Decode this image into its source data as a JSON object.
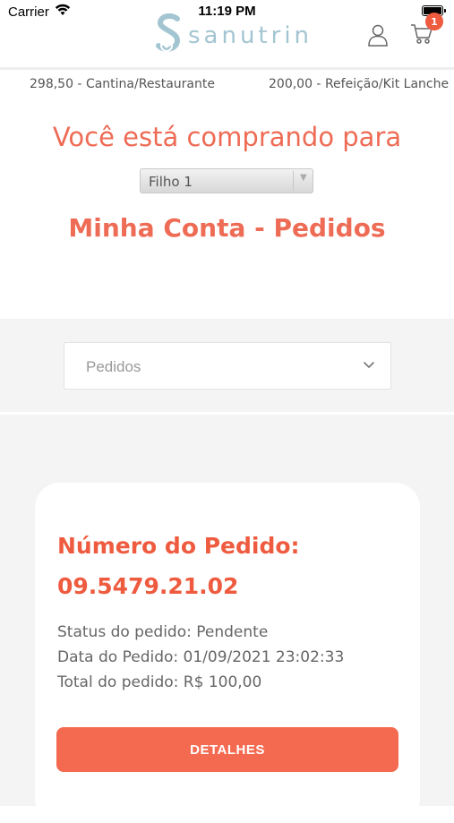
{
  "status_bar": {
    "carrier": "Carrier",
    "time": "11:19 PM"
  },
  "header": {
    "logo_text": "sanutrin",
    "cart_badge": "1",
    "icons": [
      "user-icon",
      "cart-icon",
      "wifi-icon",
      "battery-icon",
      "chevron-down-icon"
    ]
  },
  "balances": [
    "298,50 - Cantina/Restaurante",
    "200,00 - Refeição/Kit Lanche"
  ],
  "buying_for": {
    "label": "Você está comprando para",
    "selected_child": "Filho 1"
  },
  "page_heading": "Minha Conta - Pedidos",
  "orders_filter": {
    "selected": "Pedidos"
  },
  "order": {
    "title": "Número do Pedido:",
    "number": "09.5479.21.02",
    "status": "Status do pedido: Pendente",
    "date": "Data do Pedido: 01/09/2021 23:02:33",
    "total": "Total do pedido: R$ 100,00",
    "details_label": "DETALHES"
  },
  "colors": {
    "accent": "#ee5b3f",
    "button": "#f46a50",
    "logo": "#a3c5d2",
    "background_gray": "#f4f4f4"
  }
}
